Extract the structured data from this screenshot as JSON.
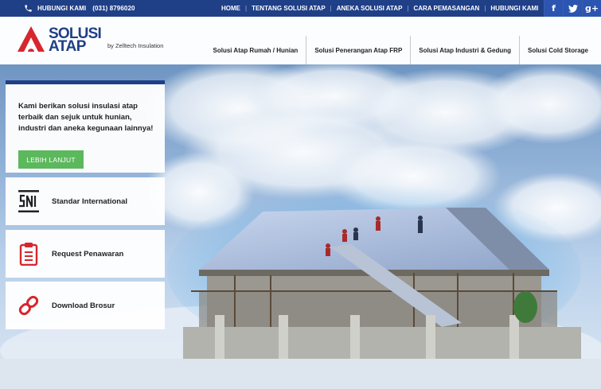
{
  "topbar": {
    "phone_label": "HUBUNGI KAMI",
    "phone_number": "(031) 8796020",
    "nav": [
      "HOME",
      "TENTANG SOLUSI ATAP",
      "ANEKA SOLUSI ATAP",
      "CARA PEMASANGAN",
      "HUBUNGI KAMI"
    ],
    "separator": "|",
    "social": [
      "f",
      "twitter-icon",
      "g+"
    ]
  },
  "header": {
    "logo_line1": "SOLUSI",
    "logo_line2": "ATAP",
    "logo_by": "by Zelltech Insulation",
    "nav": [
      "Solusi Atap Rumah / Hunian",
      "Solusi Penerangan Atap FRP",
      "Solusi Atap Industri & Gedung",
      "Solusi Cold Storage"
    ]
  },
  "intro": {
    "text": "Kami berikan solusi insulasi atap terbaik dan sejuk untuk hunian, industri dan aneka kegunaan lainnya!",
    "button": "LEBIH LANJUT"
  },
  "cards": [
    {
      "icon": "sni-icon",
      "label": "Standar International"
    },
    {
      "icon": "clipboard-icon",
      "label": "Request Penawaran"
    },
    {
      "icon": "link-icon",
      "label": "Download Brosur"
    }
  ],
  "colors": {
    "primary": "#1f3f87",
    "accent": "#d7262e",
    "button": "#5cb85c"
  }
}
